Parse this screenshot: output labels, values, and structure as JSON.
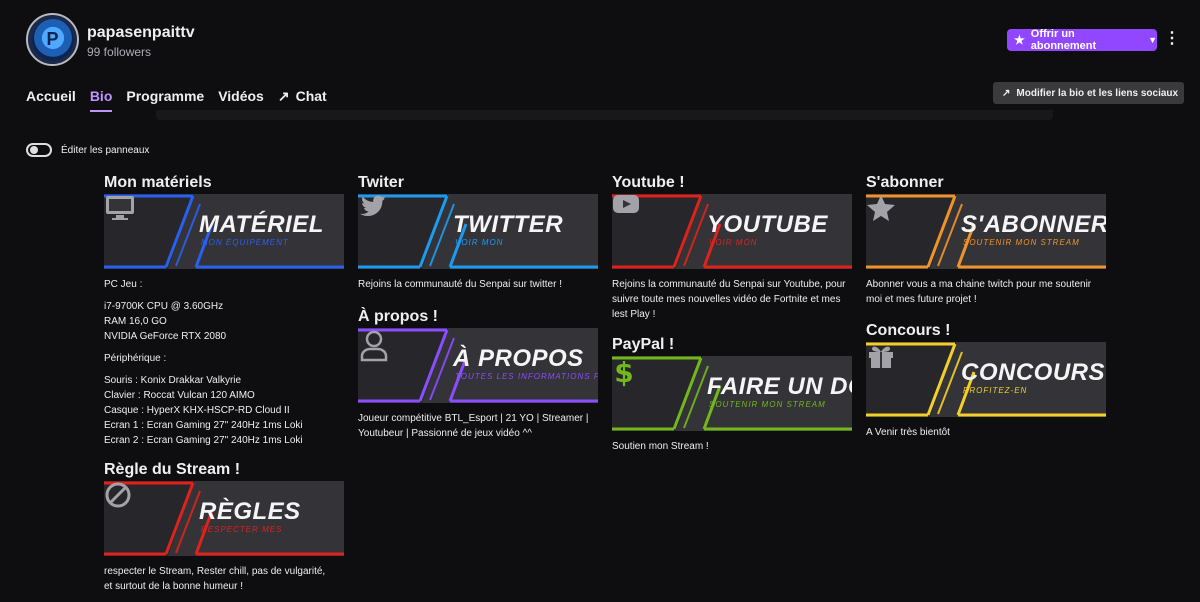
{
  "channel": {
    "name": "papasenpaittv",
    "followers": "99 followers",
    "avatar_letter": "P"
  },
  "header": {
    "subscribe_label": "Offrir un abonnement",
    "more_label": "⋮"
  },
  "nav": {
    "items": [
      "Accueil",
      "Bio",
      "Programme",
      "Vidéos",
      "Chat"
    ],
    "active": "Bio"
  },
  "edit_bio_label": "Modifier la bio et les liens sociaux",
  "edit_panels_label": "Éditer les panneaux",
  "colors": {
    "accent": "#9147ff",
    "blue": "#2a60f0",
    "twitter": "#1d9bf0",
    "red": "#e0221c",
    "orange": "#f0932b",
    "purple": "#8a4dff",
    "green": "#73b81b",
    "yellow": "#f2cf2b"
  },
  "panels": [
    {
      "title": "Mon matériels",
      "banner_title": "MATÉRIEL",
      "banner_sub": "MON ÉQUIPEMENT",
      "icon": "monitor-icon",
      "color": "#2a60f0",
      "lines": [
        "PC Jeu :",
        "",
        "i7-9700K CPU @ 3.60GHz",
        "RAM 16,0 GO",
        "NVIDIA GeForce RTX 2080",
        "",
        "Périphérique :",
        "",
        "Souris : Konix Drakkar Valkyrie",
        "Clavier : Roccat Vulcan 120 AIMO",
        "Casque : HyperX KHX-HSCP-RD Cloud II",
        "Ecran 1 : Ecran Gaming 27\" 240Hz 1ms Loki",
        "Ecran 2 : Ecran Gaming 27\" 240Hz 1ms Loki"
      ]
    },
    {
      "title": "Règle du Stream !",
      "banner_title": "RÈGLES",
      "banner_sub": "RESPECTER MES",
      "icon": "no-entry-icon",
      "color": "#e0221c",
      "lines": [
        "respecter le Stream, Rester chill, pas de vulgarité,",
        "et surtout de la bonne humeur !"
      ]
    },
    {
      "title": "Twiter",
      "banner_title": "TWITTER",
      "banner_sub": "VOIR MON",
      "icon": "twitter-icon",
      "color": "#1d9bf0",
      "lines": [
        "Rejoins la communauté du Senpai sur twitter !"
      ]
    },
    {
      "title": "À propos !",
      "banner_title": "À PROPOS",
      "banner_sub": "TOUTES LES INFORMATIONS PERSONNELLES",
      "icon": "user-icon",
      "color": "#8a4dff",
      "lines": [
        "Joueur compétitive BTL_Esport | 21 YO | Streamer |",
        "Youtubeur | Passionné de jeux vidéo ^^"
      ]
    },
    {
      "title": "Youtube !",
      "banner_title": "YOUTUBE",
      "banner_sub": "VOIR MON",
      "icon": "youtube-icon",
      "color": "#e0221c",
      "lines": [
        "Rejoins la communauté du Senpai sur Youtube, pour",
        "suivre toute mes nouvelles vidéo de Fortnite et mes",
        "lest Play !"
      ]
    },
    {
      "title": "PayPal !",
      "banner_title": "FAIRE UN DON",
      "banner_sub": "SOUTENIR MON STREAM",
      "icon": "dollar-icon",
      "color": "#73b81b",
      "lines": [
        "Soutien mon Stream !"
      ]
    },
    {
      "title": "S'abonner",
      "banner_title": "S'ABONNER",
      "banner_sub": "SOUTENIR MON STREAM",
      "icon": "star-icon",
      "color": "#f0932b",
      "lines": [
        "Abonner vous a ma chaine twitch pour me soutenir",
        "moi et mes future projet !"
      ]
    },
    {
      "title": "Concours !",
      "banner_title": "CONCOURS",
      "banner_sub": "PROFITEZ-EN",
      "icon": "gift-icon",
      "color": "#f2cf2b",
      "lines": [
        "A Venir très bientôt"
      ]
    }
  ]
}
